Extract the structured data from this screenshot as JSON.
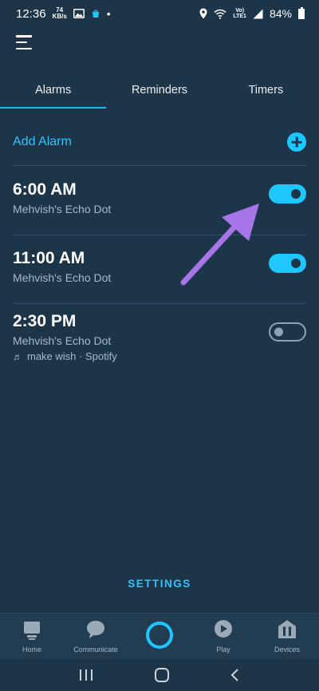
{
  "status_bar": {
    "time": "12:36",
    "speed_value": "74",
    "speed_unit": "KB/s",
    "dot": "•",
    "network_top": "Vo)",
    "network_bottom": "LTE1",
    "battery": "84%"
  },
  "tabs": [
    {
      "label": "Alarms",
      "active": true
    },
    {
      "label": "Reminders",
      "active": false
    },
    {
      "label": "Timers",
      "active": false
    }
  ],
  "add_alarm": {
    "label": "Add Alarm"
  },
  "alarms": [
    {
      "time": "6:00 AM",
      "device": "Mehvish's Echo Dot",
      "enabled": true
    },
    {
      "time": "11:00 AM",
      "device": "Mehvish's Echo Dot",
      "enabled": true
    },
    {
      "time": "2:30 PM",
      "device": "Mehvish's Echo Dot",
      "music": "make wish · Spotify",
      "enabled": false
    }
  ],
  "settings": {
    "label": "SETTINGS"
  },
  "bottom_nav": [
    {
      "label": "Home",
      "icon": "home-icon"
    },
    {
      "label": "Communicate",
      "icon": "chat-bubble-icon"
    },
    {
      "label": "",
      "icon": "alexa-icon"
    },
    {
      "label": "Play",
      "icon": "play-icon"
    },
    {
      "label": "Devices",
      "icon": "devices-icon"
    }
  ],
  "colors": {
    "background": "#1c3549",
    "accent": "#1ec7ff",
    "arrow": "#a875e8"
  }
}
